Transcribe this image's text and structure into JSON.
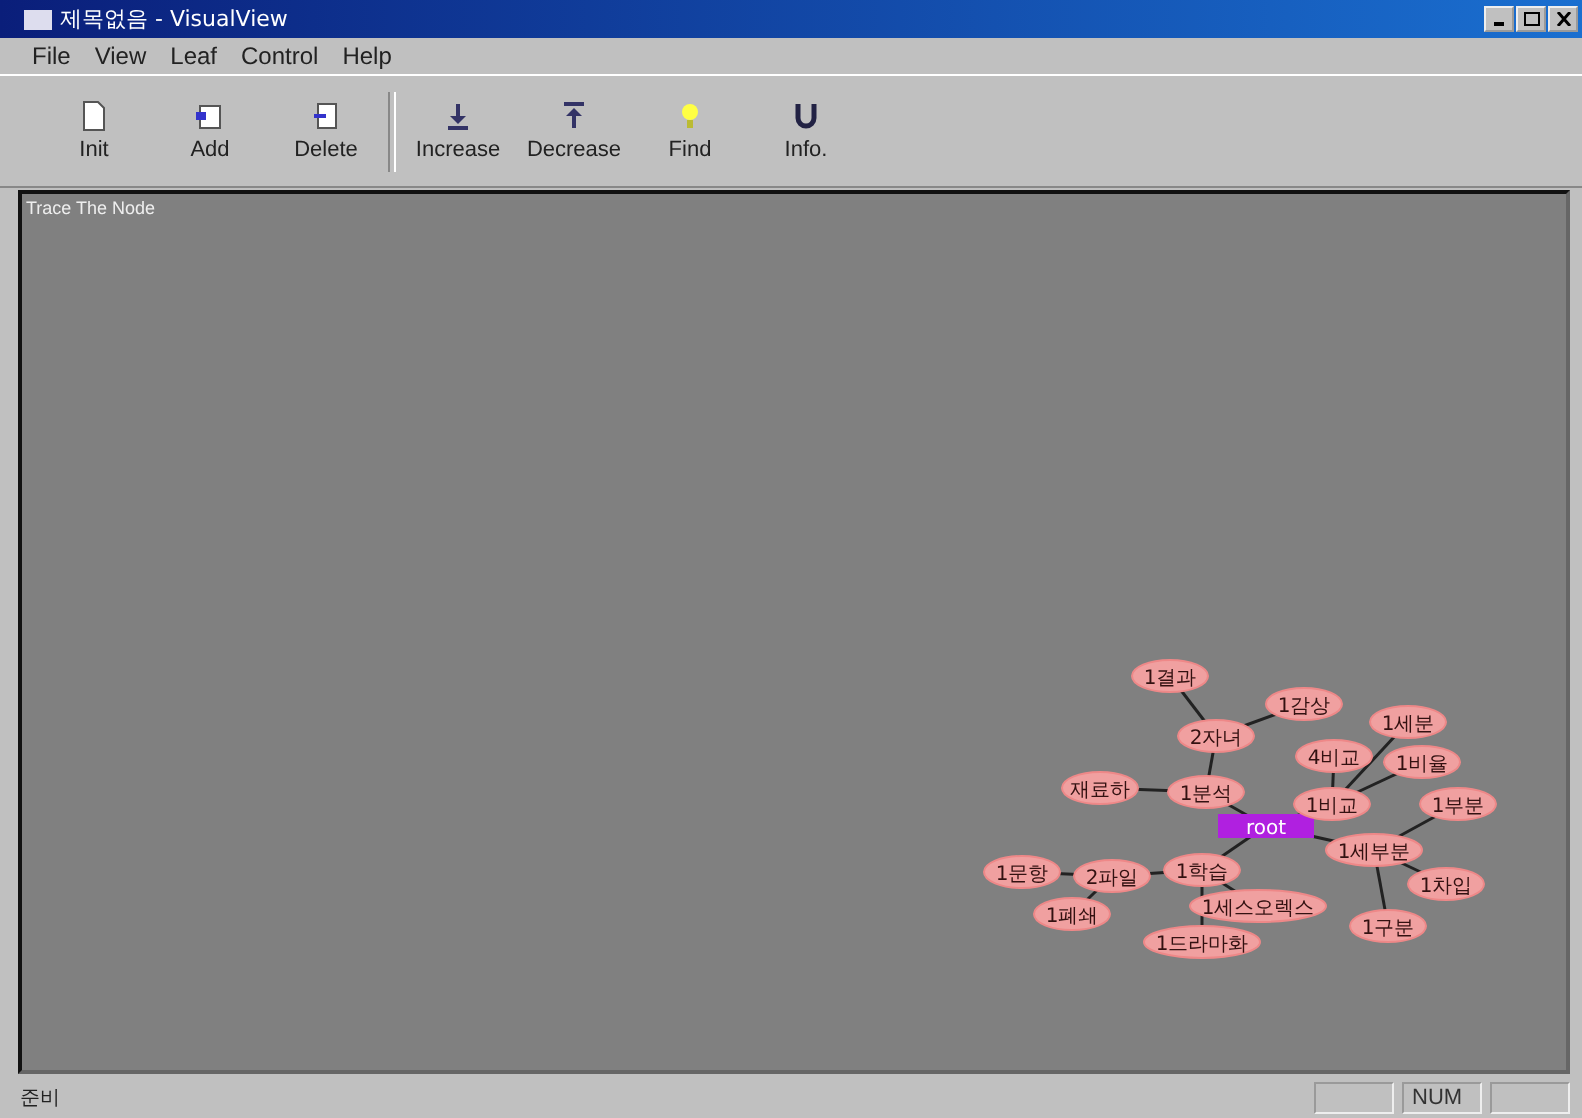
{
  "window": {
    "title": "제목없음 - VisualView"
  },
  "menu": [
    "File",
    "View",
    "Leaf",
    "Control",
    "Help"
  ],
  "toolbar": [
    {
      "label": "Init",
      "kind": "doc"
    },
    {
      "label": "Add",
      "kind": "add"
    },
    {
      "label": "Delete",
      "kind": "delete"
    },
    {
      "label": "Increase",
      "kind": "increase"
    },
    {
      "label": "Decrease",
      "kind": "decrease"
    },
    {
      "label": "Find",
      "kind": "find"
    },
    {
      "label": "Info.",
      "kind": "info"
    }
  ],
  "canvas": {
    "caption": "Trace The Node",
    "tree": {
      "label": "root",
      "selected": true,
      "children": [
        {
          "label": "1분석",
          "selected": false,
          "children": [
            {
              "label": "재료하",
              "selected": false
            },
            {
              "label": "2자녀",
              "selected": false,
              "children": [
                {
                  "label": "1결과",
                  "selected": false
                },
                {
                  "label": "1감상",
                  "selected": false
                }
              ]
            }
          ]
        },
        {
          "label": "1학습",
          "selected": false,
          "children": [
            {
              "label": "2파일",
              "selected": false,
              "children": [
                {
                  "label": "1문항",
                  "selected": false
                },
                {
                  "label": "1폐쇄",
                  "selected": false
                }
              ]
            },
            {
              "label": "1세스오렉스",
              "selected": false
            },
            {
              "label": "1드라마화",
              "selected": false
            }
          ]
        },
        {
          "label": "1비교",
          "selected": false,
          "children": [
            {
              "label": "4비교",
              "selected": false
            },
            {
              "label": "1세분",
              "selected": false
            },
            {
              "label": "1비율",
              "selected": false
            }
          ]
        },
        {
          "label": "1세부분",
          "selected": false,
          "children": [
            {
              "label": "1부분",
              "selected": false
            },
            {
              "label": "1차입",
              "selected": false
            },
            {
              "label": "1구분",
              "selected": false
            }
          ]
        }
      ]
    }
  },
  "status_bar": {
    "message": "준비",
    "indicators": [
      {
        "text": "NUM"
      }
    ]
  }
}
